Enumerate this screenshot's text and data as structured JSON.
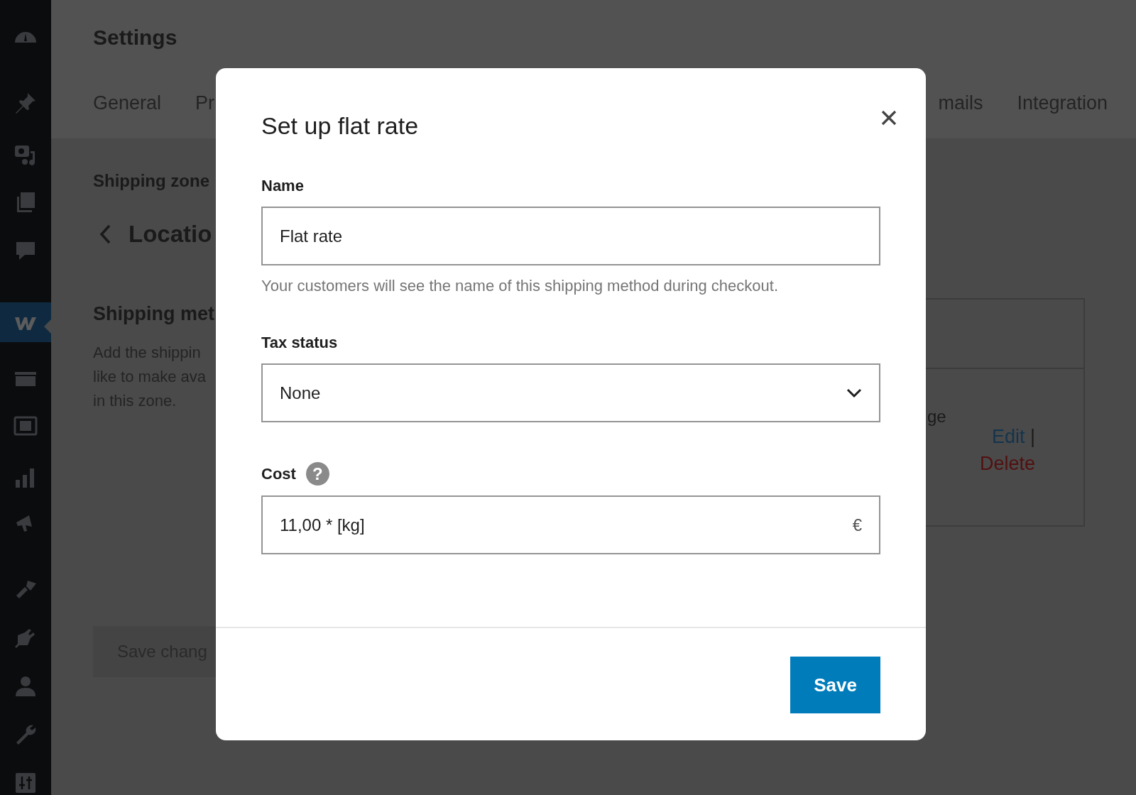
{
  "sidebar": {
    "items": [
      {
        "selected": false
      },
      {
        "selected": false
      },
      {
        "selected": false
      },
      {
        "selected": false
      },
      {
        "selected": false
      },
      {
        "selected": true
      },
      {
        "selected": false
      },
      {
        "selected": false
      },
      {
        "selected": false
      },
      {
        "selected": false
      },
      {
        "selected": false
      },
      {
        "selected": false
      },
      {
        "selected": false
      },
      {
        "selected": false
      },
      {
        "selected": false
      }
    ]
  },
  "page": {
    "title": "Settings",
    "tabs": [
      {
        "label": "General"
      },
      {
        "label": "Pr"
      },
      {
        "label": "mails"
      },
      {
        "label": "Integration"
      }
    ],
    "breadcrumb": "Shipping zone",
    "zone_title": "Locatio",
    "section_title": "Shipping met",
    "description": [
      "Add the shippin",
      "like to make ava",
      "in this zone."
    ],
    "save_button": "Save chang",
    "methods_table": {
      "row_text": [
        "ge"
      ],
      "edit": "Edit",
      "separator": "|",
      "delete": "Delete"
    }
  },
  "modal": {
    "title": "Set up flat rate",
    "name": {
      "label": "Name",
      "value": "Flat rate",
      "help": "Your customers will see the name of this shipping method during checkout."
    },
    "tax_status": {
      "label": "Tax status",
      "value": "None"
    },
    "cost": {
      "label": "Cost",
      "help_mark": "?",
      "value": "11,00 * [kg]",
      "suffix": "€"
    },
    "save": "Save"
  }
}
